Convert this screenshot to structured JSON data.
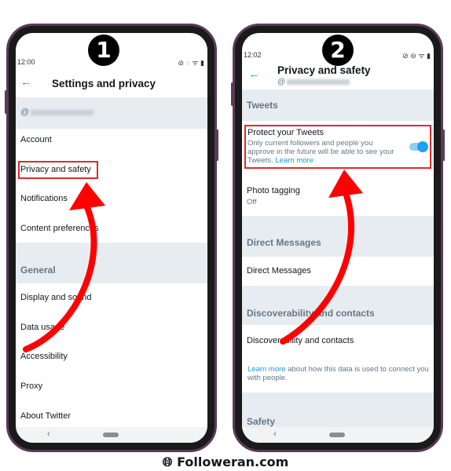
{
  "phone1": {
    "step": "1",
    "time": "12:00",
    "title": "Settings and privacy",
    "handle_prefix": "@",
    "items": [
      "Account",
      "Privacy and safety",
      "Notifications",
      "Content preferences"
    ],
    "section": "General",
    "general_items": [
      "Display and sound",
      "Data usage",
      "Accessibility",
      "Proxy",
      "About Twitter"
    ]
  },
  "phone2": {
    "step": "2",
    "time": "12:02",
    "title": "Privacy and safety",
    "handle_prefix": "@",
    "tweets_section": "Tweets",
    "protect": {
      "title": "Protect your Tweets",
      "desc": "Only current followers and people you approve in the future will be able to see your Tweets.",
      "link": "Learn more",
      "enabled": true
    },
    "photo_tagging": {
      "title": "Photo tagging",
      "value": "Off"
    },
    "dm_section": "Direct Messages",
    "dm_item": "Direct Messages",
    "disc_section": "Discoverability and contacts",
    "disc_item": "Discoverability and contacts",
    "info_link": "Learn more",
    "info_text": " about how this data is used to connect you with people.",
    "next_section": "Safety"
  },
  "footer": {
    "brand": "Followeran.com",
    "icon": "globe-icon"
  },
  "colors": {
    "accent": "#1da1f2",
    "highlight": "#e0282e",
    "arrow": "#ff0000",
    "frame": "#5a3b57"
  }
}
